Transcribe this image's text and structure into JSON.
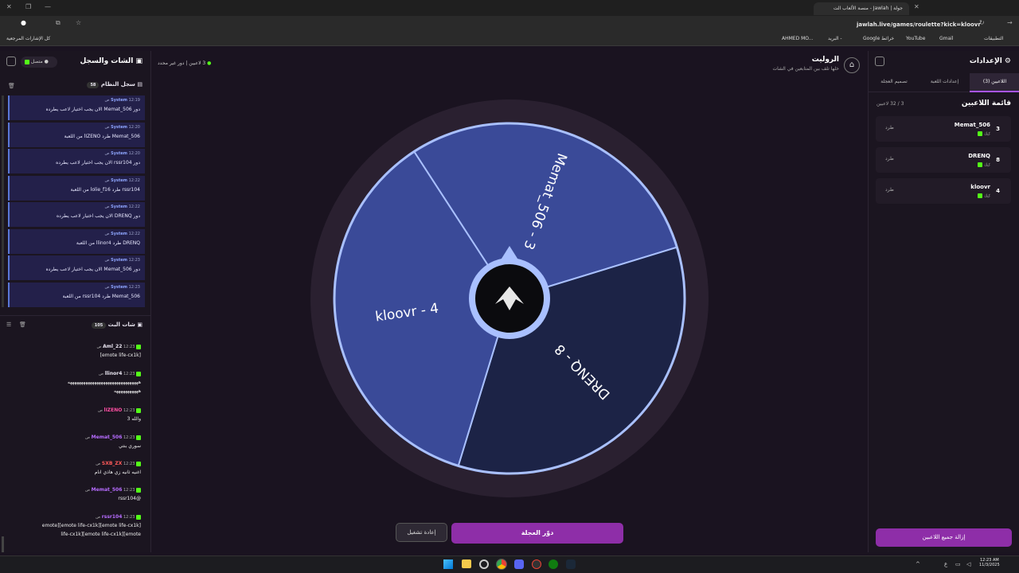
{
  "browser": {
    "tab_title": "جولة | Jawlah - منصة الألعاب الت",
    "url": "jawlah.live/games/roulette?kick=kloovr",
    "bookmarks": [
      "التطبيقات",
      "Gmail",
      "YouTube",
      "Google خرائط",
      "البريد -",
      "AHMED MO...",
      "كل الإشارات المرجعية"
    ]
  },
  "left_panel": {
    "title": "الشات والسجل",
    "status": "متصل",
    "system_log": {
      "title": "سجل النظام",
      "count": "58"
    },
    "logs": [
      {
        "sender": "System",
        "time": "12:19 ص",
        "msg": "دور Memat_506 الان يجب اختيار لاعب يطرده"
      },
      {
        "sender": "System",
        "time": "12:20 ص",
        "msg": "Memat_506 طرد lIZENO من اللعبة"
      },
      {
        "sender": "System",
        "time": "12:20 ص",
        "msg": "دور rssr104 الان يجب اختيار لاعب يطرده"
      },
      {
        "sender": "System",
        "time": "12:22 ص",
        "msg": "rssr104 طرد lolie_f16 من اللعبة"
      },
      {
        "sender": "System",
        "time": "12:22 ص",
        "msg": "دور DRENQ الان يجب اختيار لاعب يطرده"
      },
      {
        "sender": "System",
        "time": "12:22 ص",
        "msg": "DRENQ طرد llinor4 من اللعبة"
      },
      {
        "sender": "System",
        "time": "12:23 ص",
        "msg": "دور Memat_506 الان يجب اختيار لاعب يطرده"
      },
      {
        "sender": "System",
        "time": "12:23 ص",
        "msg": "Memat_506 طرد rssr104 من اللعبة"
      }
    ],
    "live_chat": {
      "title": "شات البث",
      "count": "105"
    },
    "chat": [
      {
        "user": "Aml_22",
        "color": "#e8e4ef",
        "time": "12:23 ص",
        "lines": [
          "[emote life-cx1k]"
        ]
      },
      {
        "user": "llinor4",
        "color": "#e8e4ef",
        "time": "12:23 ص",
        "lines": [
          "ههههههههههههههههههههههههههههههههه",
          "هههههههههههه"
        ]
      },
      {
        "user": "lIZENO",
        "color": "#ff4fa3",
        "time": "12:23 ص",
        "lines": [
          "والله 3"
        ]
      },
      {
        "user": "Memat_506",
        "color": "#b76cff",
        "time": "12:23 ص",
        "lines": [
          "سوري بنتي"
        ]
      },
      {
        "user": "SXB_ZX",
        "color": "#ff5a5a",
        "time": "12:23 ص",
        "lines": [
          "اغنيه ثانيه زي هاذي انام"
        ]
      },
      {
        "user": "Memat_506",
        "color": "#b76cff",
        "time": "12:23 ص",
        "lines": [
          "@rssr104"
        ]
      },
      {
        "user": "rssr104",
        "color": "#b76cff",
        "time": "12:23 ص",
        "lines": [
          "[emote life-cx1k][emote life-cx1k][emote",
          "life-cx1k][emote life-cx1k][emote"
        ]
      }
    ]
  },
  "header": {
    "title": "الروليت",
    "subtitle": "خلها تلف بين المتابعين في الشات",
    "players_count": "3 لاعبين",
    "round": "دور غير محدد"
  },
  "wheel": {
    "segments": [
      {
        "label": "Memat_506 - 3",
        "color": "#3a4a98",
        "start": -123,
        "end": -17
      },
      {
        "label": "DRENQ - 8",
        "color": "#1c2346",
        "start": -17,
        "end": 107
      },
      {
        "label": "kloovr - 4",
        "color": "#3a4a98",
        "start": 107,
        "end": 237
      }
    ]
  },
  "buttons": {
    "spin": "دوّر العجلة",
    "restart": "إعادة تشغيل",
    "remove_all": "إزالة جميع اللاعبين"
  },
  "right_panel": {
    "title": "الإعدادات",
    "tabs": [
      "اللاعبين (3)",
      "إعدادات اللعبة",
      "تصميم العجلة"
    ],
    "list_title": "قائمة اللاعبين",
    "list_count": "3 / 32 لاعبين",
    "players": [
      {
        "num": "3",
        "name": "Memat_506",
        "sub": "كيك",
        "kick": "طرد"
      },
      {
        "num": "8",
        "name": "DRENQ",
        "sub": "كيك",
        "kick": "طرد"
      },
      {
        "num": "4",
        "name": "kloovr",
        "sub": "كيك",
        "kick": "طرد"
      }
    ]
  },
  "taskbar": {
    "time": "12:23 AM",
    "date": "11/3/2025",
    "lang": "ع"
  }
}
